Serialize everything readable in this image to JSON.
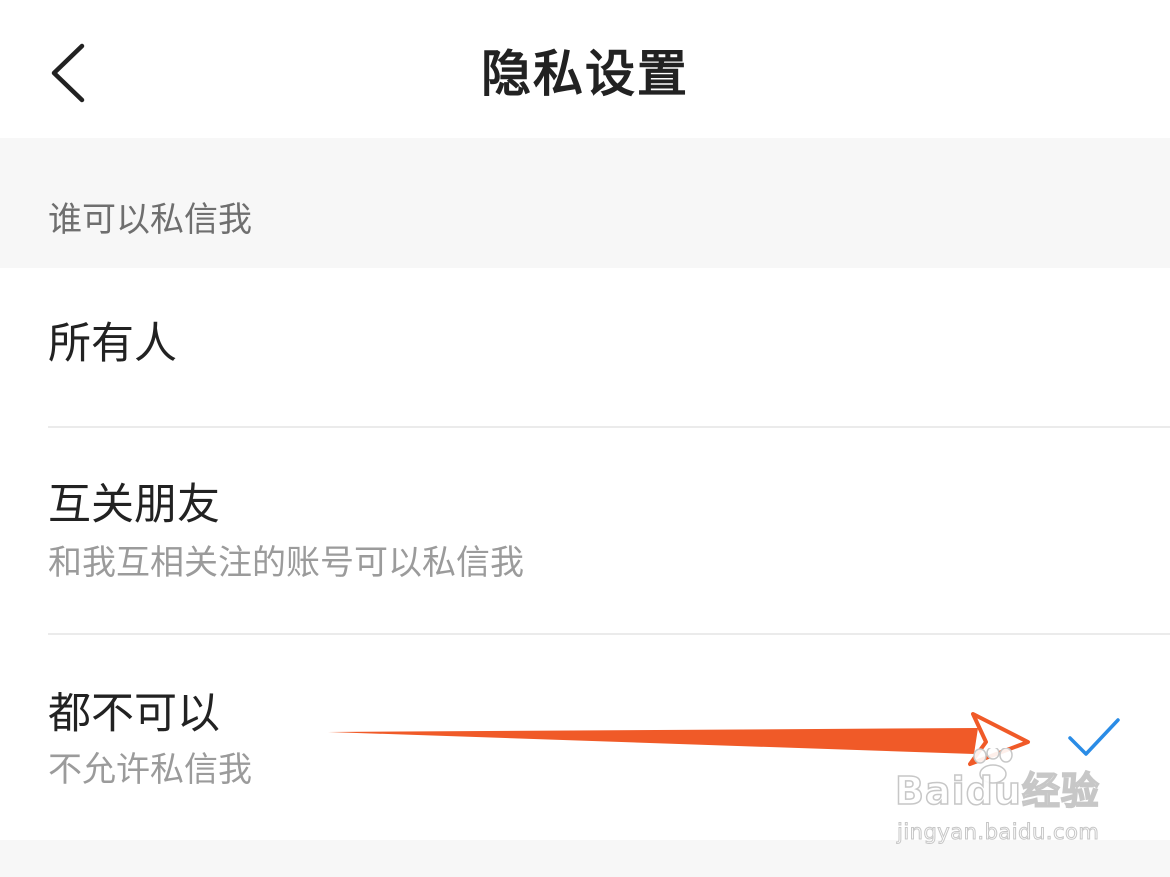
{
  "header": {
    "title": "隐私设置",
    "back_icon": "chevron-left-icon"
  },
  "section": {
    "label": "谁可以私信我"
  },
  "options": [
    {
      "title": "所有人",
      "subtitle": "",
      "selected": false
    },
    {
      "title": "互关朋友",
      "subtitle": "和我互相关注的账号可以私信我",
      "selected": false
    },
    {
      "title": "都不可以",
      "subtitle": "不允许私信我",
      "selected": true
    }
  ],
  "selected_marker_icon": "checkmark-icon",
  "annotation": {
    "icon": "arrow-pointer-icon",
    "color": "#f05a28"
  },
  "watermark": {
    "brand": "Baidu经验",
    "url": "jingyan.baidu.com"
  },
  "colors": {
    "accent": "#2a8ce6",
    "section_bg": "#f7f7f7",
    "divider": "#ebebeb",
    "primary_text": "#222222",
    "secondary_text": "#9b9b9b"
  }
}
